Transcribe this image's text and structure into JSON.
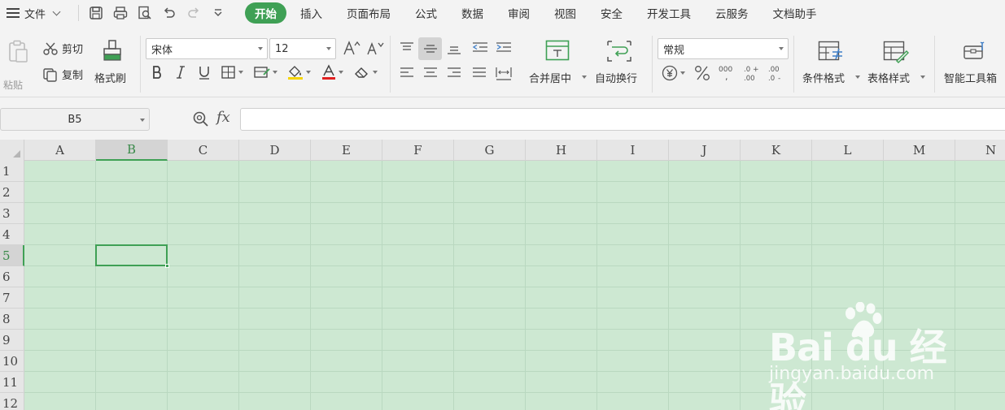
{
  "menu": {
    "file_label": "文件",
    "tabs": [
      {
        "label": "开始",
        "active": true
      },
      {
        "label": "插入"
      },
      {
        "label": "页面布局"
      },
      {
        "label": "公式"
      },
      {
        "label": "数据"
      },
      {
        "label": "审阅"
      },
      {
        "label": "视图"
      },
      {
        "label": "安全"
      },
      {
        "label": "开发工具"
      },
      {
        "label": "云服务"
      },
      {
        "label": "文档助手"
      }
    ]
  },
  "ribbon": {
    "paste_label": "粘贴",
    "cut_label": "剪切",
    "copy_label": "复制",
    "format_painter_label": "格式刷",
    "font_name": "宋体",
    "font_size": "12",
    "merge_center_label": "合并居中",
    "wrap_text_label": "自动换行",
    "number_format": "常规",
    "conditional_format_label": "条件格式",
    "table_style_label": "表格样式",
    "smart_toolbox_label": "智能工具箱"
  },
  "formula_bar": {
    "cell_ref": "B5",
    "fx_label": "fx",
    "formula": ""
  },
  "sheet": {
    "columns": [
      "A",
      "B",
      "C",
      "D",
      "E",
      "F",
      "G",
      "H",
      "I",
      "J",
      "K",
      "L",
      "M",
      "N"
    ],
    "rows": [
      "1",
      "2",
      "3",
      "4",
      "5",
      "6",
      "7",
      "8",
      "9",
      "10",
      "11",
      "12"
    ],
    "selected_column": "B",
    "selected_row": "5"
  },
  "watermark": {
    "brand": "Bai du 经验",
    "url": "jingyan.baidu.com"
  },
  "colors": {
    "accent": "#3fa055",
    "grid_background": "#cde8d2",
    "header_background": "#e6e6e6"
  }
}
